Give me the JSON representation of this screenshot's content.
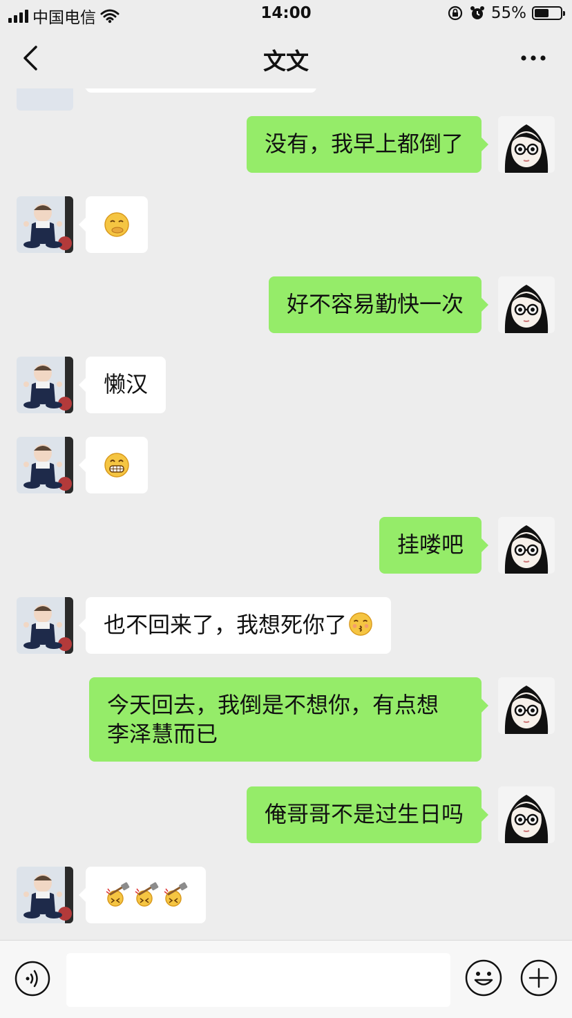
{
  "status_bar": {
    "carrier": "中国电信",
    "time": "14:00",
    "battery_text": "55%",
    "battery_level": 0.55
  },
  "nav": {
    "title": "文文"
  },
  "messages": [
    {
      "side": "out",
      "text": "没有，我早上都倒了"
    },
    {
      "side": "in",
      "emoji": "hush-emoji"
    },
    {
      "side": "out",
      "text": "好不容易勤快一次"
    },
    {
      "side": "in",
      "text": "懒汉"
    },
    {
      "side": "in",
      "emoji": "grin-emoji"
    },
    {
      "side": "out",
      "text": "挂喽吧"
    },
    {
      "side": "in",
      "text": "也不回来了，我想死你了",
      "trailing_emoji": "kiss-emoji"
    },
    {
      "side": "out",
      "text_lines": [
        "今天回去，我倒是不想你，有点想",
        "李泽慧而已"
      ]
    },
    {
      "side": "out",
      "text": "俺哥哥不是过生日吗"
    },
    {
      "side": "in",
      "emoji_repeat": [
        "hammer-emoji",
        "hammer-emoji",
        "hammer-emoji"
      ]
    }
  ],
  "input": {
    "placeholder": "",
    "value": ""
  },
  "colors": {
    "outgoing_bubble": "#95ec69",
    "incoming_bubble": "#ffffff",
    "background": "#ededed"
  }
}
